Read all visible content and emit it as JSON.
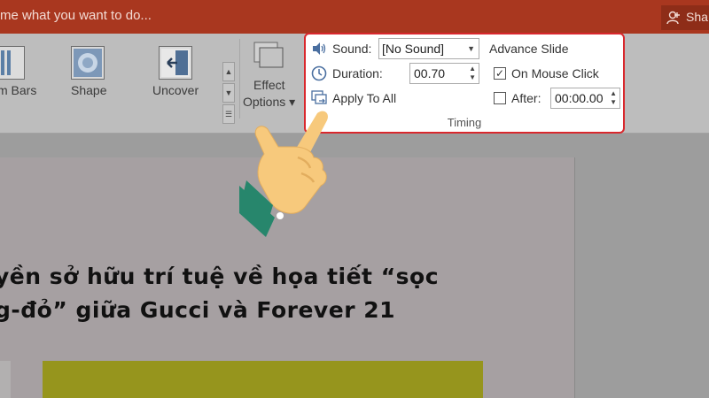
{
  "titlebar": {
    "tell_me": "me what you want to do...",
    "share_label": "Sha"
  },
  "ribbon": {
    "items": [
      {
        "label": "m Bars"
      },
      {
        "label": "Shape"
      },
      {
        "label": "Uncover"
      }
    ],
    "effect_options": {
      "line1": "Effect",
      "line2": "Options ▾"
    }
  },
  "timing": {
    "sound_label": "Sound:",
    "sound_value": "[No Sound]",
    "duration_label": "Duration:",
    "duration_value": "00.70",
    "apply_all_label": "Apply To All",
    "advance_title": "Advance Slide",
    "on_mouse_click_label": "On Mouse Click",
    "on_mouse_click_checked": true,
    "after_label": "After:",
    "after_checked": false,
    "after_value": "00:00.00",
    "group_label": "Timing"
  },
  "slide": {
    "title_line1": "yền sở hữu trí tuệ về họa tiết “sọc",
    "title_line2": "g-đỏ” giữa Gucci và Forever 21"
  },
  "colors": {
    "titlebar": "#a9371f",
    "highlight_border": "#d9282d",
    "cuff": "#27866c",
    "skin": "#f7c97c",
    "yellow_block": "#96951d"
  }
}
